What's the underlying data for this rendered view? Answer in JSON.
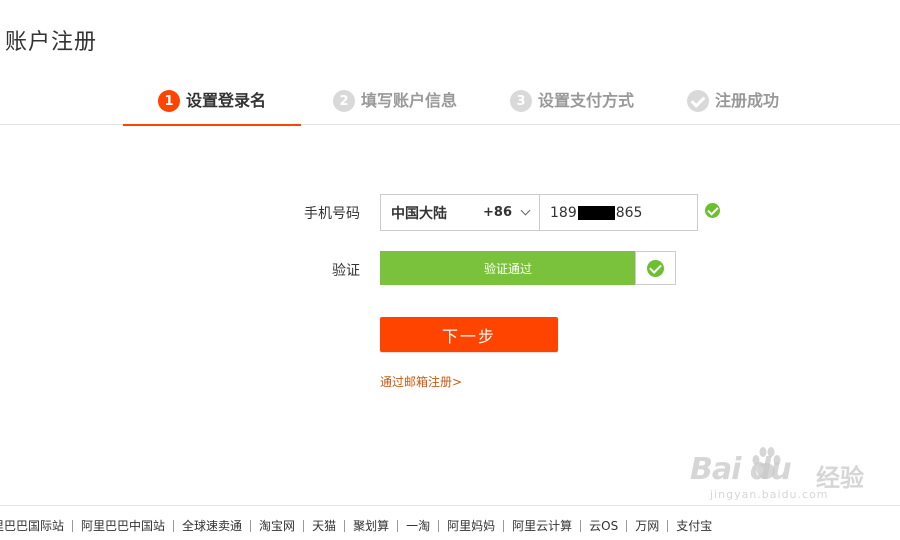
{
  "page": {
    "title": "账户注册"
  },
  "steps": [
    {
      "num": "1",
      "label": "设置登录名",
      "active": true
    },
    {
      "num": "2",
      "label": "填写账户信息",
      "active": false
    },
    {
      "num": "3",
      "label": "设置支付方式",
      "active": false
    },
    {
      "num": "",
      "label": "注册成功",
      "active": false
    }
  ],
  "form": {
    "phone_label": "手机号码",
    "country": "中国大陆",
    "country_code": "+86",
    "phone_prefix": "189",
    "phone_suffix": "865",
    "verify_label": "验证",
    "verify_status": "验证通过",
    "next_button": "下一步",
    "email_link": "通过邮箱注册>"
  },
  "footer": {
    "links": [
      "里巴巴国际站",
      "阿里巴巴中国站",
      "全球速卖通",
      "淘宝网",
      "天猫",
      "聚划算",
      "一淘",
      "阿里妈妈",
      "阿里云计算",
      "云OS",
      "万网",
      "支付宝"
    ]
  },
  "watermark": {
    "logo": "Bai du",
    "text": "经验",
    "url": "jingyan.baidu.com"
  },
  "colors": {
    "accent": "#ff4400",
    "success": "#7ac23c",
    "link": "#c85a14",
    "inactive": "#d9d9d9"
  }
}
